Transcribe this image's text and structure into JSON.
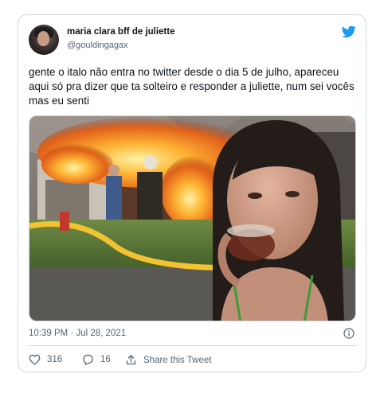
{
  "tweet": {
    "display_name": "maria clara bff de juliette",
    "handle": "@gouldingagax",
    "text": "gente o italo não entra no twitter desde o dia 5 de julho, apareceu aqui só pra dizer que ta solteiro e responder a juliette, num sei vocês mas eu senti",
    "timestamp": "10:39 PM · Jul 28, 2021"
  },
  "actions": {
    "likes": "316",
    "replies": "16",
    "share_label": "Share this Tweet"
  },
  "icons": {
    "brand": "twitter-bird-icon",
    "info": "info-icon",
    "like": "heart-icon",
    "reply": "reply-icon",
    "share": "share-icon"
  },
  "colors": {
    "twitter_blue": "#1d9bf0",
    "text": "#0f1419",
    "muted": "#536471",
    "border": "#cfd9de"
  }
}
